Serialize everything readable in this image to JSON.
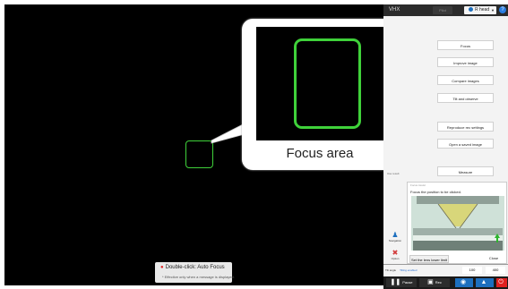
{
  "viewer": {
    "zoom_label": "Focus area",
    "hint_line1": "Double-click: Auto Focus",
    "hint_line2": "* Effective only when a message is displayed."
  },
  "panel": {
    "app_title": "VHX",
    "top_pill": "Pilot",
    "mode_label": "R head",
    "help_glyph": "?",
    "buttons": [
      {
        "label": "Focus"
      },
      {
        "label": "Improve image"
      },
      {
        "label": "Compare images"
      },
      {
        "label": "Tilt and observe"
      },
      {
        "label": "Reproduce rec settings"
      },
      {
        "label": "Open a saved image"
      },
      {
        "label": "Measure"
      }
    ],
    "section_label": "Use result",
    "popup": {
      "title": "Focus Assist",
      "message": "Focus the position to be clicked.",
      "lens_button": "Set the lens lower limit",
      "close_button": "Close"
    },
    "side_nav": {
      "label": "Navigation"
    },
    "side_options": {
      "label": "Option"
    },
    "status": {
      "text": "Tilt angle",
      "subtext": "Tilting enabled"
    },
    "zoom_values": [
      "100",
      "400"
    ],
    "bottom": {
      "pause": "Pause",
      "rec": "Rec"
    }
  },
  "colors": {
    "focus_green": "#3fd13a",
    "viewer_bg": "#000000",
    "accent_blue": "#2a7de1",
    "record_red": "#e02020"
  }
}
